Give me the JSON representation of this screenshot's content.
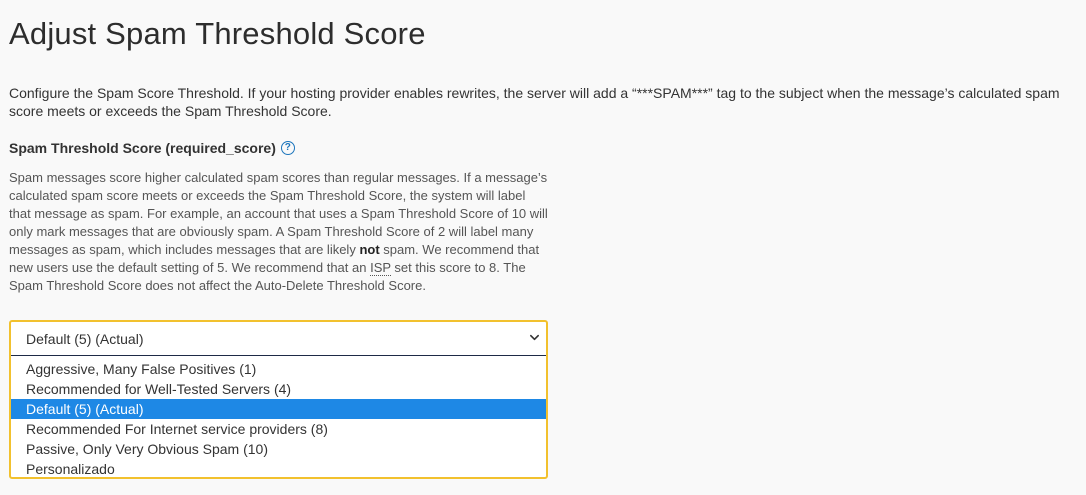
{
  "page": {
    "title": "Adjust Spam Threshold Score",
    "intro": "Configure the Spam Score Threshold. If your hosting provider enables rewrites, the server will add a “***SPAM***” tag to the subject when the message’s calculated spam score meets or exceeds the Spam Threshold Score."
  },
  "field": {
    "label": "Spam Threshold Score (required_score)",
    "help_icon": "question-circle-icon",
    "help_text": {
      "part1": "Spam messages score higher calculated spam scores than regular messages. If a message’s calculated spam score meets or exceeds the Spam Threshold Score, the system will label that message as spam. For example, an account that uses a Spam Threshold Score of 10 will only mark messages that are obviously spam. A Spam Threshold Score of 2 will label many messages as spam, which includes messages that are likely ",
      "emphasis": "not",
      "part2": " spam. We recommend that new users use the default setting of 5. We recommend that an ",
      "abbr": "ISP",
      "part3": " set this score to 8. The Spam Threshold Score does not affect the Auto-Delete Threshold Score."
    }
  },
  "select": {
    "current_value": "Default (5) (Actual)",
    "options": [
      "Aggressive, Many False Positives (1)",
      "Recommended for Well-Tested Servers (4)",
      "Default (5) (Actual)",
      "Recommended For Internet service providers (8)",
      "Passive, Only Very Obvious Spam (10)",
      "Personalizado"
    ],
    "highlighted_index": 2
  },
  "colors": {
    "focus_border": "#f2c12e",
    "selected_option_bg": "#1e88e5",
    "help_icon": "#1c75bc"
  }
}
